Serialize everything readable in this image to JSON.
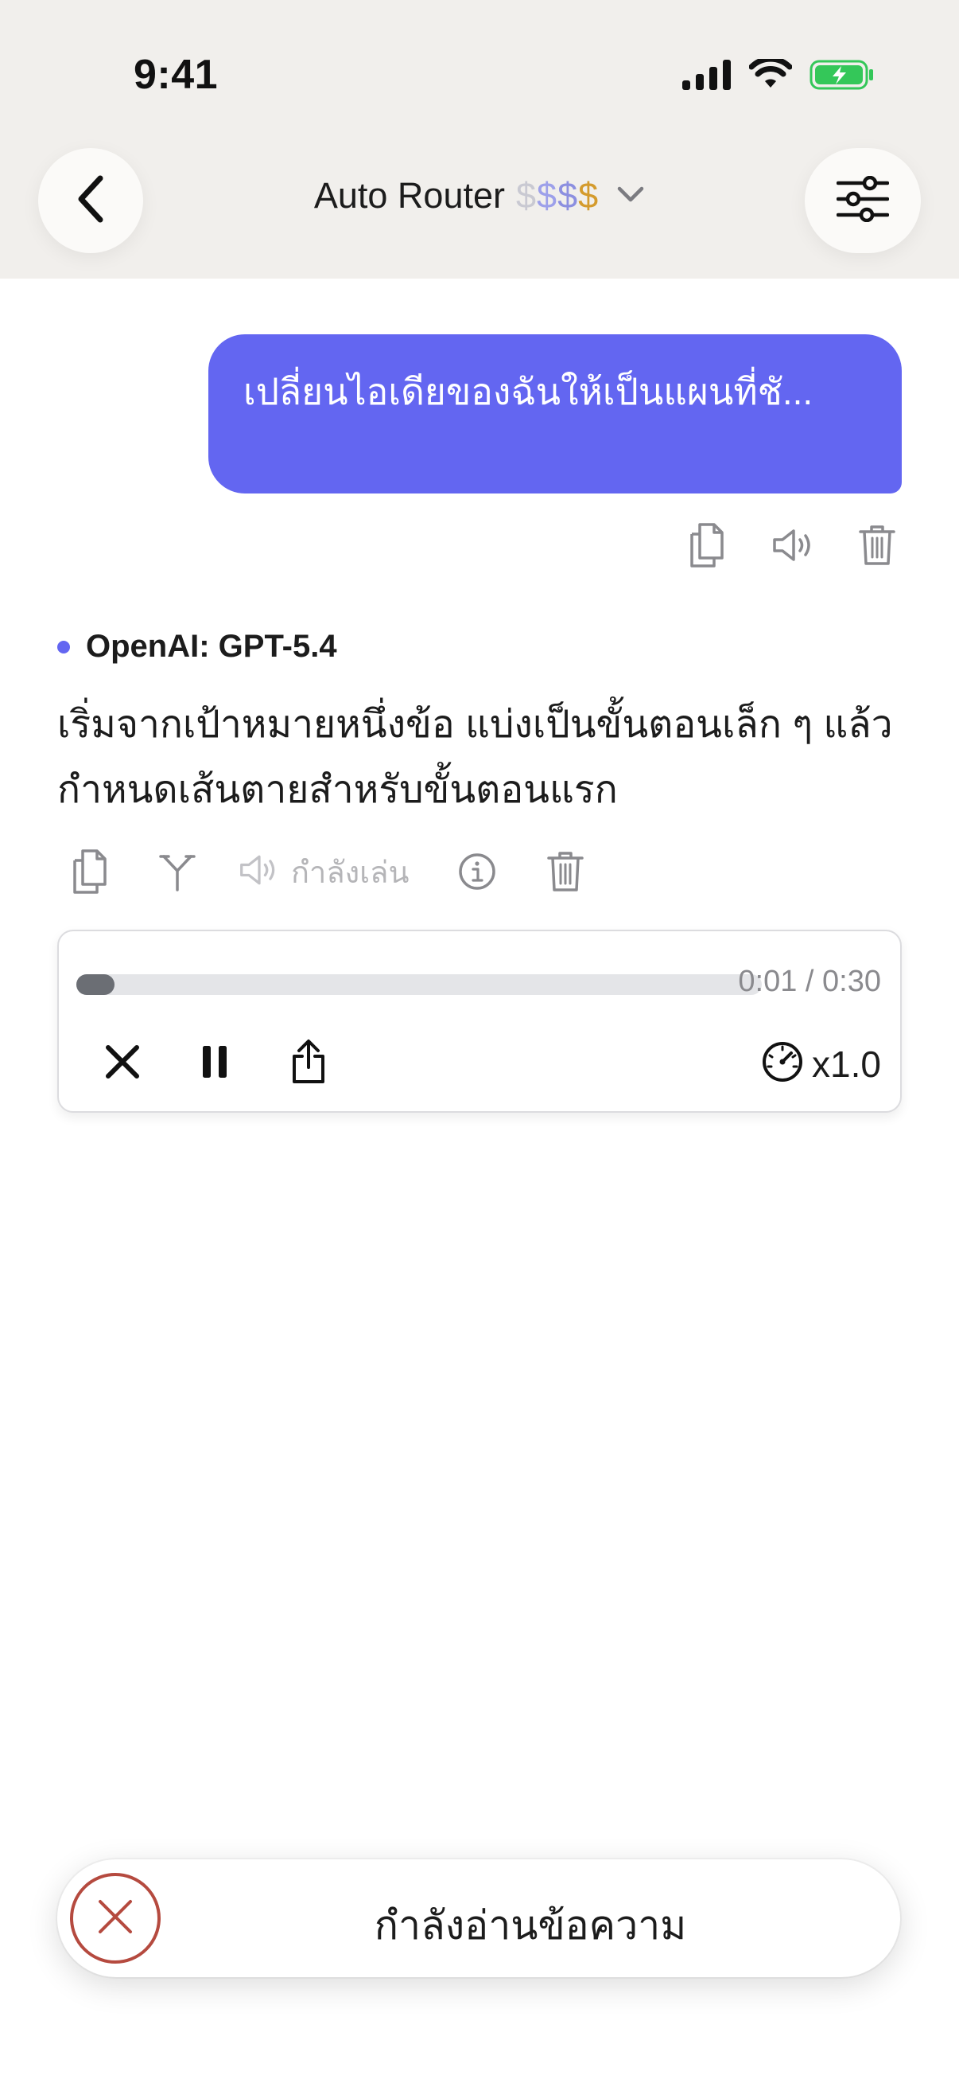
{
  "status_bar": {
    "time": "9:41"
  },
  "header": {
    "title": "Auto Router",
    "price_tier": [
      "$",
      "$",
      "$",
      "$"
    ],
    "back_icon": "chevron-left-icon",
    "settings_icon": "sliders-icon",
    "dropdown_icon": "chevron-down-icon"
  },
  "user_message": {
    "text": "เปลี่ยนไอเดียของฉันให้เป็นแผนที่ชั...",
    "actions": [
      "copy-icon",
      "speaker-icon",
      "trash-icon"
    ]
  },
  "assistant_message": {
    "model": "OpenAI: GPT-5.4",
    "text_lines": [
      "เริ่มจากเป้าหมายหนึ่งข้อ แบ่งเป็นขั้นตอนเล็ก ๆ แล้ว",
      "กำหนดเส้นตายสำหรับขั้นตอนแรก"
    ],
    "playing_label": "กำลังเล่น",
    "actions": [
      "copy-icon",
      "branch-icon",
      "speaker-icon",
      "info-icon",
      "trash-icon"
    ]
  },
  "audio_player": {
    "elapsed": "0:01",
    "duration": "0:30",
    "time_readout": "0:01 / 0:30",
    "progress": 0.033,
    "speed": "x1.0"
  },
  "bottom_bar": {
    "label": "กำลังอ่านข้อความ"
  },
  "colors": {
    "accent": "#6366f1",
    "header_bg": "#f1efec",
    "stop_red": "#b54a3f",
    "battery_green": "#34c759"
  }
}
